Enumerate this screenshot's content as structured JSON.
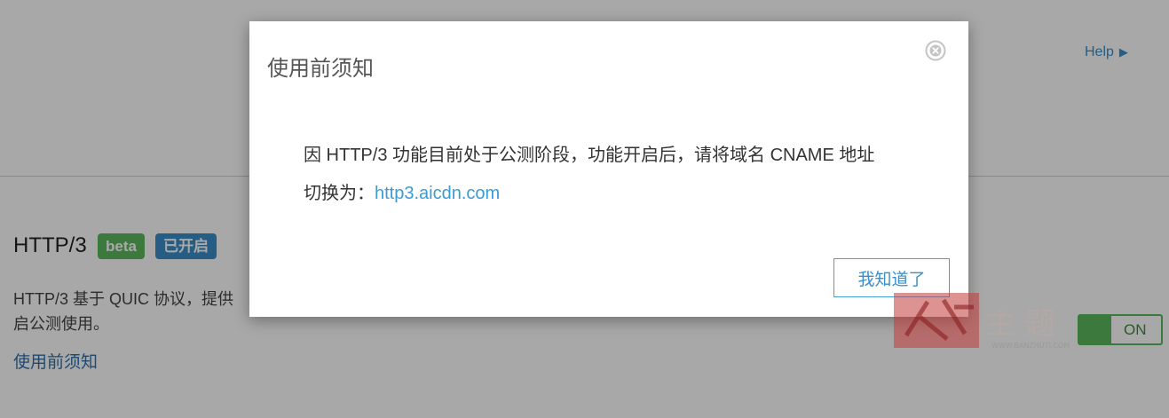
{
  "header": {
    "help_label": "Help"
  },
  "feature": {
    "title": "HTTP/3",
    "badge_beta": "beta",
    "badge_status": "已开启",
    "description": "HTTP/3 基于 QUIC 协议，提供",
    "description_cont": "启公测使用。",
    "guide_link": "使用前须知",
    "toggle_label": "ON",
    "toggle_on": true
  },
  "modal": {
    "title": "使用前须知",
    "body_line1": "因 HTTP/3 功能目前处于公测阶段，功能开启后，请将域名 CNAME 地址",
    "body_line2_prefix": "切换为：",
    "body_url": "http3.aicdn.com",
    "confirm_label": "我知道了"
  },
  "watermark": {
    "text": "主 题",
    "url": "WWW.BANZHUTI.COM"
  },
  "colors": {
    "accent": "#3a8ec9",
    "success": "#5cb85c",
    "overlay": "rgba(0,0,0,0.34)"
  }
}
